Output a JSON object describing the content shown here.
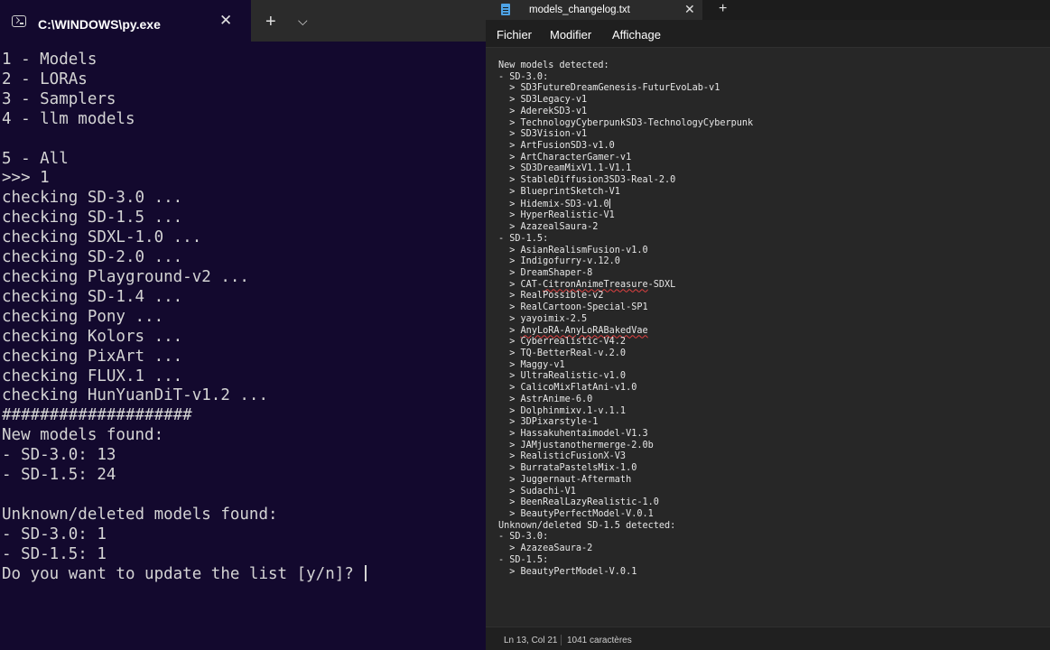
{
  "terminal": {
    "tab_title": "C:\\WINDOWS\\py.exe",
    "close_glyph": "✕",
    "new_tab_glyph": "+",
    "dropdown_glyph": "⌵",
    "icon": "terminal-icon",
    "background": "#13092e",
    "lines": [
      "1 - Models",
      "2 - LORAs",
      "3 - Samplers",
      "4 - llm models",
      "",
      "5 - All",
      ">>> 1",
      "checking SD-3.0 ...",
      "checking SD-1.5 ...",
      "checking SDXL-1.0 ...",
      "checking SD-2.0 ...",
      "checking Playground-v2 ...",
      "checking SD-1.4 ...",
      "checking Pony ...",
      "checking Kolors ...",
      "checking PixArt ...",
      "checking FLUX.1 ...",
      "checking HunYuanDiT-v1.2 ...",
      "####################",
      "New models found:",
      "- SD-3.0: 13",
      "- SD-1.5: 24",
      "",
      "Unknown/deleted models found:",
      "- SD-3.0: 1",
      "- SD-1.5: 1",
      "Do you want to update the list [y/n]? "
    ]
  },
  "notepad": {
    "tab_title": "models_changelog.txt",
    "file_icon": "notepad-file-icon",
    "close_glyph": "✕",
    "new_tab_glyph": "+",
    "menu": [
      "Fichier",
      "Modifier",
      "Affichage"
    ],
    "accent": "#4ea3e6",
    "lines": [
      {
        "text": "New models detected:"
      },
      {
        "text": "- SD-3.0:"
      },
      {
        "text": "  > SD3FutureDreamGenesis-FuturEvoLab-v1"
      },
      {
        "text": "  > SD3Legacy-v1"
      },
      {
        "text": "  > AderekSD3-v1"
      },
      {
        "text": "  > TechnologyCyberpunkSD3-TechnologyCyberpunk"
      },
      {
        "text": "  > SD3Vision-v1"
      },
      {
        "text": "  > ArtFusionSD3-v1.0"
      },
      {
        "text": "  > ArtCharacterGamer-v1"
      },
      {
        "text": "  > SD3DreamMixV1.1-V1.1"
      },
      {
        "text": "  > StableDiffusion3SD3-Real-2.0"
      },
      {
        "text": "  > BlueprintSketch-V1"
      },
      {
        "text": "  > Hidemix-SD3-v1.0",
        "caret": true
      },
      {
        "text": "  > HyperRealistic-V1"
      },
      {
        "text": "  > AzazealSaura-2"
      },
      {
        "text": "- SD-1.5:"
      },
      {
        "text": "  > AsianRealismFusion-v1.0"
      },
      {
        "text": "  > Indigofurry-v.12.0"
      },
      {
        "text": "  > DreamShaper-8"
      },
      {
        "text": "  > CAT-CitronAnimeTreasure-SDXL",
        "squiggle": [
          8,
          27
        ]
      },
      {
        "text": "  > RealPossible-v2"
      },
      {
        "text": "  > RealCartoon-Special-SP1"
      },
      {
        "text": "  > yayoimix-2.5"
      },
      {
        "text": "  > AnyLoRA-AnyLoRABakedVae",
        "squiggle": [
          4,
          27
        ]
      },
      {
        "text": "  > Cyberrealistic-V4.2"
      },
      {
        "text": "  > TQ-BetterReal-v.2.0"
      },
      {
        "text": "  > Maggy-v1"
      },
      {
        "text": "  > UltraRealistic-v1.0"
      },
      {
        "text": "  > CalicoMixFlatAni-v1.0"
      },
      {
        "text": "  > AstrAnime-6.0"
      },
      {
        "text": "  > Dolphinmixv.1-v.1.1"
      },
      {
        "text": "  > 3DPixarstyle-1"
      },
      {
        "text": "  > Hassakuhentaimodel-V1.3"
      },
      {
        "text": "  > JAMjustanothermerge-2.0b"
      },
      {
        "text": "  > RealisticFusionX-V3"
      },
      {
        "text": "  > BurrataPastelsMix-1.0"
      },
      {
        "text": "  > Juggernaut-Aftermath"
      },
      {
        "text": "  > Sudachi-V1"
      },
      {
        "text": "  > BeenRealLazyRealistic-1.0"
      },
      {
        "text": "  > BeautyPerfectModel-V.0.1"
      },
      {
        "text": "Unknown/deleted SD-1.5 detected:"
      },
      {
        "text": "- SD-3.0:"
      },
      {
        "text": "  > AzazeaSaura-2"
      },
      {
        "text": "- SD-1.5:"
      },
      {
        "text": "  > BeautyPertModel-V.0.1"
      }
    ],
    "status": {
      "position": "Ln 13, Col 21",
      "chars": "1041 caractères"
    }
  }
}
